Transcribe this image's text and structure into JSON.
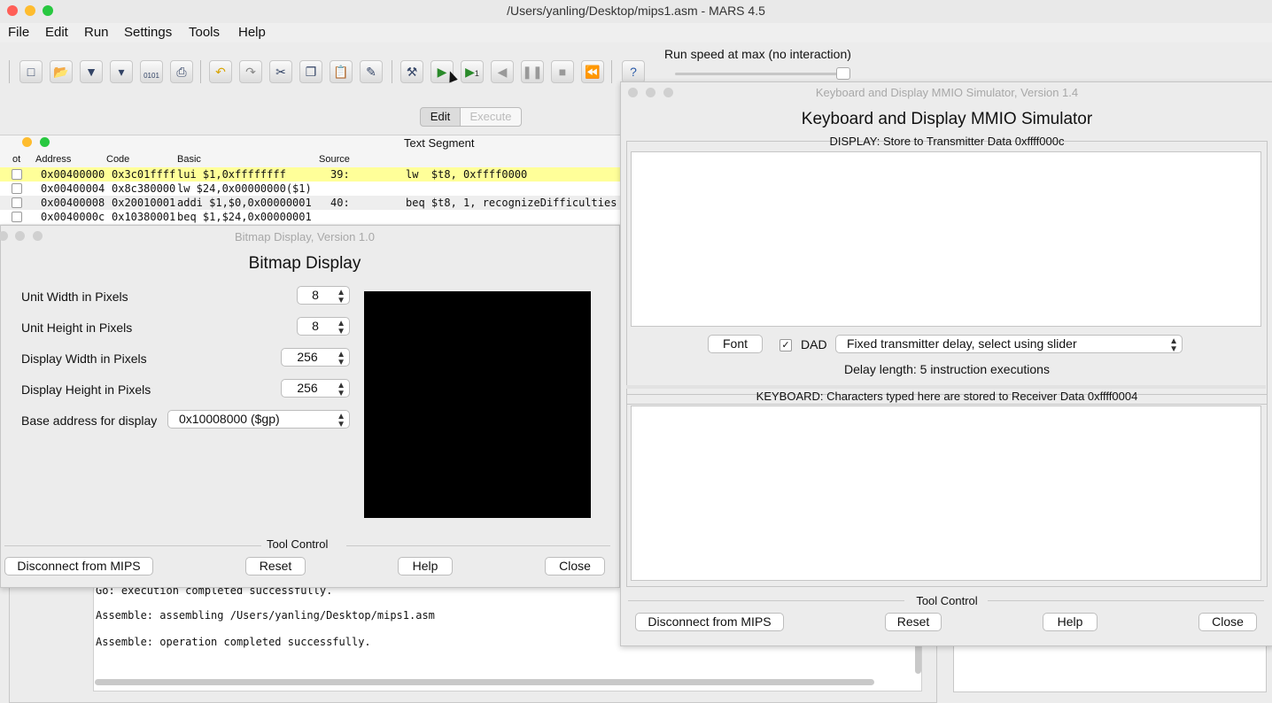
{
  "window": {
    "title": "/Users/yanling/Desktop/mips1.asm - MARS 4.5"
  },
  "menu": {
    "file": "File",
    "edit": "Edit",
    "run": "Run",
    "settings": "Settings",
    "tools": "Tools",
    "help": "Help"
  },
  "toolbar": {
    "run_speed_label": "Run speed at max (no interaction)",
    "speed_level": 1.0,
    "icons": [
      "new-file-icon",
      "open-icon",
      "save-icon",
      "save-as-icon",
      "dump-icon",
      "print-icon",
      "undo-icon",
      "redo-icon",
      "cut-icon",
      "copy-icon",
      "paste-icon",
      "find-replace-icon",
      "assemble-icon",
      "run-icon",
      "step-icon",
      "backstep-icon",
      "pause-icon",
      "stop-icon",
      "reset-icon",
      "help-icon"
    ],
    "step_glyph": "1",
    "dump_glyph": "0101"
  },
  "tabs": {
    "edit": "Edit",
    "execute": "Execute"
  },
  "text_segment": {
    "title": "Text Segment",
    "columns": {
      "bkpt": "ot",
      "address": "Address",
      "code": "Code",
      "basic": "Basic",
      "source": "Source"
    },
    "rows": [
      {
        "address": "0x00400000",
        "code": "0x3c01ffff",
        "basic": "lui $1,0xffffffff",
        "line": "39:",
        "source": "lw  $t8, 0xffff0000"
      },
      {
        "address": "0x00400004",
        "code": "0x8c380000",
        "basic": "lw $24,0x00000000($1)",
        "line": "",
        "source": ""
      },
      {
        "address": "0x00400008",
        "code": "0x20010001",
        "basic": "addi $1,$0,0x00000001",
        "line": "40:",
        "source": "beq $t8, 1, recognizeDifficulties"
      },
      {
        "address": "0x0040000c",
        "code": "0x10380001",
        "basic": "beq $1,$24,0x00000001",
        "line": "",
        "source": ""
      }
    ]
  },
  "bitmap": {
    "window_title": "Bitmap Display, Version 1.0",
    "heading": "Bitmap Display",
    "unit_width_label": "Unit Width in Pixels",
    "unit_width": "8",
    "unit_height_label": "Unit Height in Pixels",
    "unit_height": "8",
    "display_width_label": "Display Width in Pixels",
    "display_width": "256",
    "display_height_label": "Display Height in Pixels",
    "display_height": "256",
    "base_address_label": "Base address for display",
    "base_address": "0x10008000 ($gp)",
    "tool_control": "Tool Control",
    "disconnect": "Disconnect from MIPS",
    "reset": "Reset",
    "help": "Help",
    "close": "Close"
  },
  "messages": {
    "lines": [
      "Go: execution completed successfully.",
      "Assemble: assembling /Users/yanling/Desktop/mips1.asm",
      "Assemble: operation completed successfully."
    ]
  },
  "mmio": {
    "window_title": "Keyboard and Display MMIO Simulator, Version 1.4",
    "heading": "Keyboard and Display MMIO Simulator",
    "display_label": "DISPLAY: Store to Transmitter Data 0xffff000c",
    "font_button": "Font",
    "dad_label": "DAD",
    "dad_checked": true,
    "delay_select": "Fixed transmitter delay, select using slider",
    "delay_length": "Delay length: 5 instruction executions",
    "keyboard_label": "KEYBOARD: Characters typed here are stored to Receiver Data 0xffff0004",
    "tool_control": "Tool Control",
    "disconnect": "Disconnect from MIPS",
    "reset": "Reset",
    "help": "Help",
    "close": "Close"
  }
}
